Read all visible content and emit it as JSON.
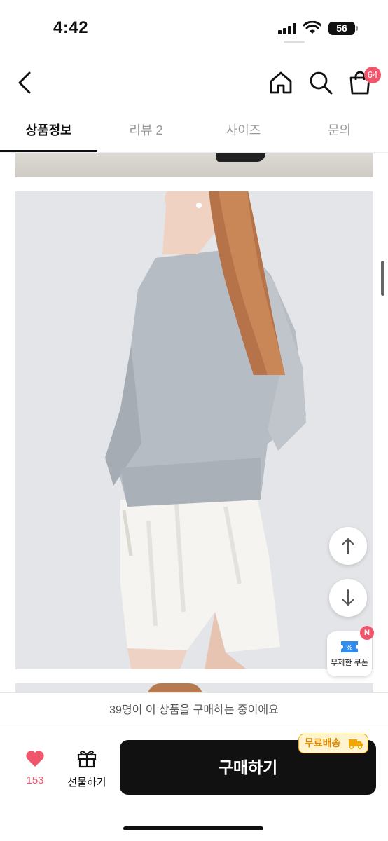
{
  "status_bar": {
    "time": "4:42",
    "battery": "56"
  },
  "header": {
    "cart_count": "64"
  },
  "tabs": [
    {
      "label": "상품정보",
      "active": true
    },
    {
      "label": "리뷰 2",
      "active": false
    },
    {
      "label": "사이즈",
      "active": false
    },
    {
      "label": "문의",
      "active": false
    }
  ],
  "coupon": {
    "label": "무제한 쿠폰",
    "badge": "N"
  },
  "notice": "39명이 이 상품을 구매하는 중이에요",
  "actions": {
    "like_count": "153",
    "gift_label": "선물하기",
    "buy_label": "구매하기",
    "shipping_badge": "무료배송"
  },
  "colors": {
    "accent": "#f0566b",
    "primary": "#111111",
    "shipping": "#f2a600"
  }
}
